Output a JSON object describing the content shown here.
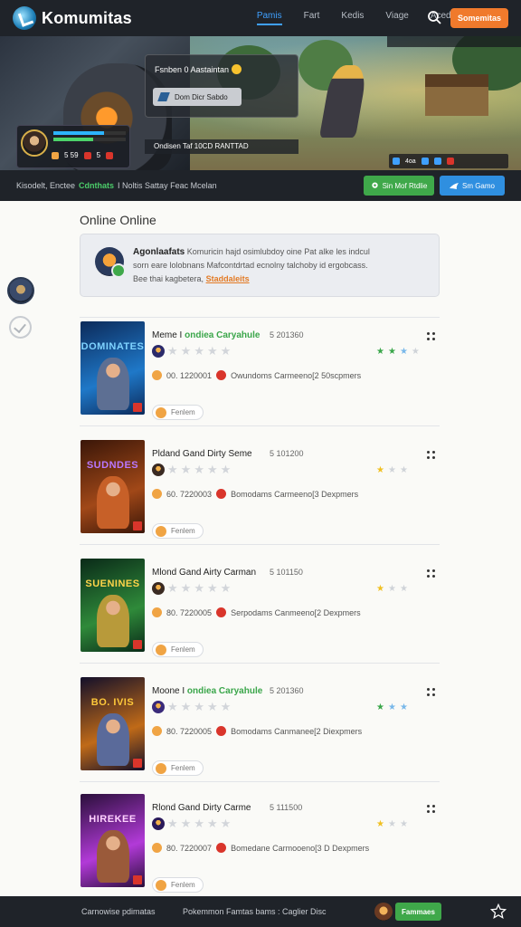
{
  "header": {
    "brand": "Komumitas",
    "nav": [
      "Pamis",
      "Fart",
      "Kedis",
      "Viage",
      "Acedo"
    ],
    "cta": "Somemitas"
  },
  "hero": {
    "panel_title": "Fsnben 0 Aastaintan",
    "panel_button": "Dom Dicr Sabdo",
    "caption": "Ondisen Taf 10CD RANTTAD",
    "player_stats": [
      "5 59",
      "5"
    ],
    "hud_label": "4oa"
  },
  "strip": {
    "crumb_prefix": "Kisodelt, Enctee",
    "crumb_highlight": "Cdnthats",
    "crumb_suffix": "I Noltis Sattay Feac Mcelan",
    "btn_green": "Sin Mof Rtdlie",
    "btn_blue": "Sm Gamo"
  },
  "main": {
    "section_title": "Online Online",
    "notice": {
      "title": "Agonlaafats",
      "body1": " Komuricin hajd osimlubdoy oine Pat alke les indcul",
      "body2": "sorn eare lolobnans Mafcontdrtad ecnolny talchoby id ergobcass.",
      "body3": "Bee thai kagbetera,",
      "link": "Staddaleits"
    }
  },
  "games": [
    {
      "title": "Meme I",
      "genre": "ondiea Caryahule",
      "date": "5 201360",
      "stats": "00. 1220001",
      "desc": "Owundoms Carmeeno[2 50scpmers",
      "pill": "Fenlem",
      "thumb_title": "DOMINATES",
      "colors": {
        "bg1": "#0c2a5a",
        "bg2": "#1f78c8",
        "fig": "#5d6f93",
        "text": "#7fd3ff",
        "icon": "#2b2a6a"
      },
      "stars_filled": 0,
      "mini_stars": [
        "#3aa64a",
        "#3aa64a",
        "#79b8ea",
        "#cfd3d8"
      ]
    },
    {
      "title": "Pldand Gand Dirty Seme",
      "genre": "",
      "date": "5 101200",
      "stats": "60. 7220003",
      "desc": "Bomodams Carmeeno[3 Dexpmers",
      "pill": "Fenlem",
      "thumb_title": "SUDNDES",
      "colors": {
        "bg1": "#3a1608",
        "bg2": "#a14818",
        "fig": "#c76028",
        "text": "#b977ff",
        "icon": "#3a2a22"
      },
      "stars_filled": 0,
      "mini_stars": [
        "#f0c022",
        "#cfd3d8",
        "#cfd3d8"
      ]
    },
    {
      "title": "Mlond Gand Airty Carman",
      "genre": "",
      "date": "5 101150",
      "stats": "80. 7220005",
      "desc": "Serpodams Canmeeno[2 Dexpmers",
      "pill": "Fenlem",
      "thumb_title": "SUENINES",
      "colors": {
        "bg1": "#0a2a18",
        "bg2": "#2f8a3a",
        "fig": "#b89a3a",
        "text": "#ffd54a",
        "icon": "#3a2a22"
      },
      "stars_filled": 0,
      "mini_stars": [
        "#f0c022",
        "#cfd3d8",
        "#cfd3d8"
      ]
    },
    {
      "title": "Moone I",
      "genre": "ondiea Caryahule",
      "date": "5 201360",
      "stats": "80. 7220005",
      "desc": "Bomodams Canmanee[2 Diexpmers",
      "pill": "Fenlem",
      "thumb_title": "BO. IVIS",
      "colors": {
        "bg1": "#120f2a",
        "bg2": "#c06a18",
        "fig": "#5a6a9a",
        "text": "#ffc93a",
        "icon": "#3a2a7a"
      },
      "stars_filled": 0,
      "mini_stars": [
        "#3aa64a",
        "#79b8ea",
        "#79b8ea"
      ]
    },
    {
      "title": "Rlond Gand Dirty Carme",
      "genre": "",
      "date": "5 111500",
      "stats": "80. 7220007",
      "desc": "Bomedane Carmooeno[3 D Dexpmers",
      "pill": "Fenlem",
      "thumb_title": "HIREKEE",
      "colors": {
        "bg1": "#2a0f3a",
        "bg2": "#b23ad8",
        "fig": "#9a5a3a",
        "text": "#ffd2ff",
        "icon": "#2a1a5a"
      },
      "stars_filled": 0,
      "mini_stars": [
        "#f0c022",
        "#cfd3d8",
        "#cfd3d8"
      ]
    }
  ],
  "footer": {
    "left": "Carnowise pdimatas",
    "mid": "Pokemmon Famtas bams : Caglier Disc",
    "button": "Fammaes"
  }
}
